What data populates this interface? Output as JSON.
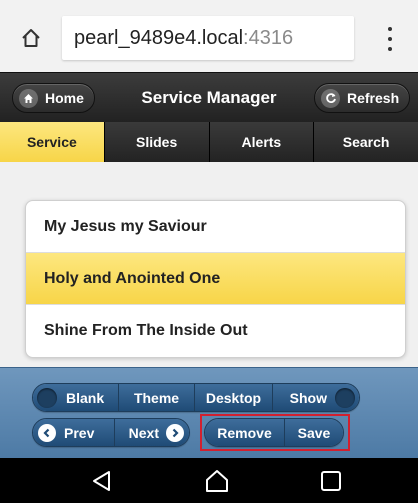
{
  "browser": {
    "url_host": "pearl_9489e4.local",
    "url_port": ":4316"
  },
  "header": {
    "title": "Service Manager",
    "home_label": "Home",
    "refresh_label": "Refresh"
  },
  "tabs": [
    {
      "label": "Service",
      "active": true
    },
    {
      "label": "Slides",
      "active": false
    },
    {
      "label": "Alerts",
      "active": false
    },
    {
      "label": "Search",
      "active": false
    }
  ],
  "service_items": [
    {
      "title": "My Jesus my Saviour",
      "selected": false
    },
    {
      "title": "Holy and Anointed One",
      "selected": true
    },
    {
      "title": "Shine From The Inside Out",
      "selected": false
    }
  ],
  "controls": {
    "blank_label": "Blank",
    "theme_label": "Theme",
    "desktop_label": "Desktop",
    "show_label": "Show",
    "prev_label": "Prev",
    "next_label": "Next",
    "remove_label": "Remove",
    "save_label": "Save"
  },
  "colors": {
    "accent_yellow": "#f7d548",
    "header_dark": "#2c2c2c",
    "footer_blue": "#5e88b1",
    "highlight_red": "#d2202f"
  },
  "icons": {
    "browser_home": "home-outline-icon",
    "browser_menu": "vertical-dots-icon",
    "home": "house-icon",
    "refresh": "refresh-icon",
    "prev": "chevron-left-icon",
    "next": "chevron-right-icon",
    "nav_back": "triangle-back-icon",
    "nav_home": "circle-home-icon",
    "nav_recents": "square-recents-icon"
  }
}
